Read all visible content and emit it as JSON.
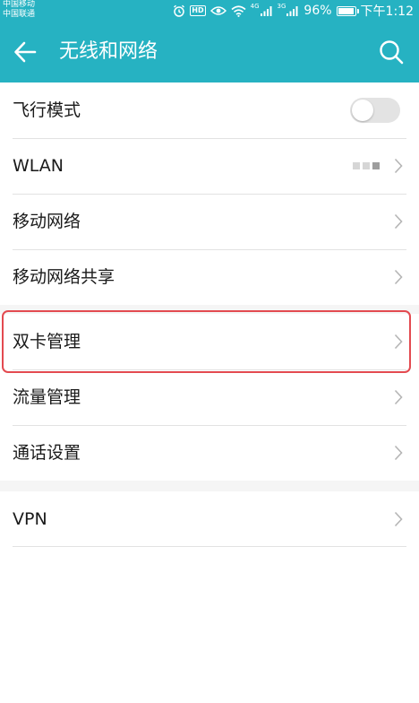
{
  "status_bar": {
    "carrier_1": "中国移动",
    "carrier_2": "中国联通",
    "hd": "HD",
    "net_1": "4G",
    "net_2": "3G",
    "battery": "96%",
    "battery_level": 0.96,
    "time": "下午1:12"
  },
  "toolbar": {
    "title": "无线和网络",
    "back_icon": "arrow-left-icon",
    "search_icon": "search-icon"
  },
  "colors": {
    "accent": "#26b2c2",
    "highlight_border": "#e34a50",
    "toggle_off": "#e3e3e3"
  },
  "settings_groups": [
    {
      "items": [
        {
          "label": "飞行模式",
          "control": "toggle",
          "on": false
        },
        {
          "label": "WLAN",
          "control": "chevron"
        },
        {
          "label": "移动网络",
          "control": "chevron"
        },
        {
          "label": "移动网络共享",
          "control": "chevron"
        }
      ]
    },
    {
      "items": [
        {
          "label": "双卡管理",
          "control": "chevron",
          "highlighted": true
        },
        {
          "label": "流量管理",
          "control": "chevron"
        },
        {
          "label": "通话设置",
          "control": "chevron"
        }
      ]
    },
    {
      "items": [
        {
          "label": "VPN",
          "control": "chevron"
        }
      ]
    }
  ]
}
